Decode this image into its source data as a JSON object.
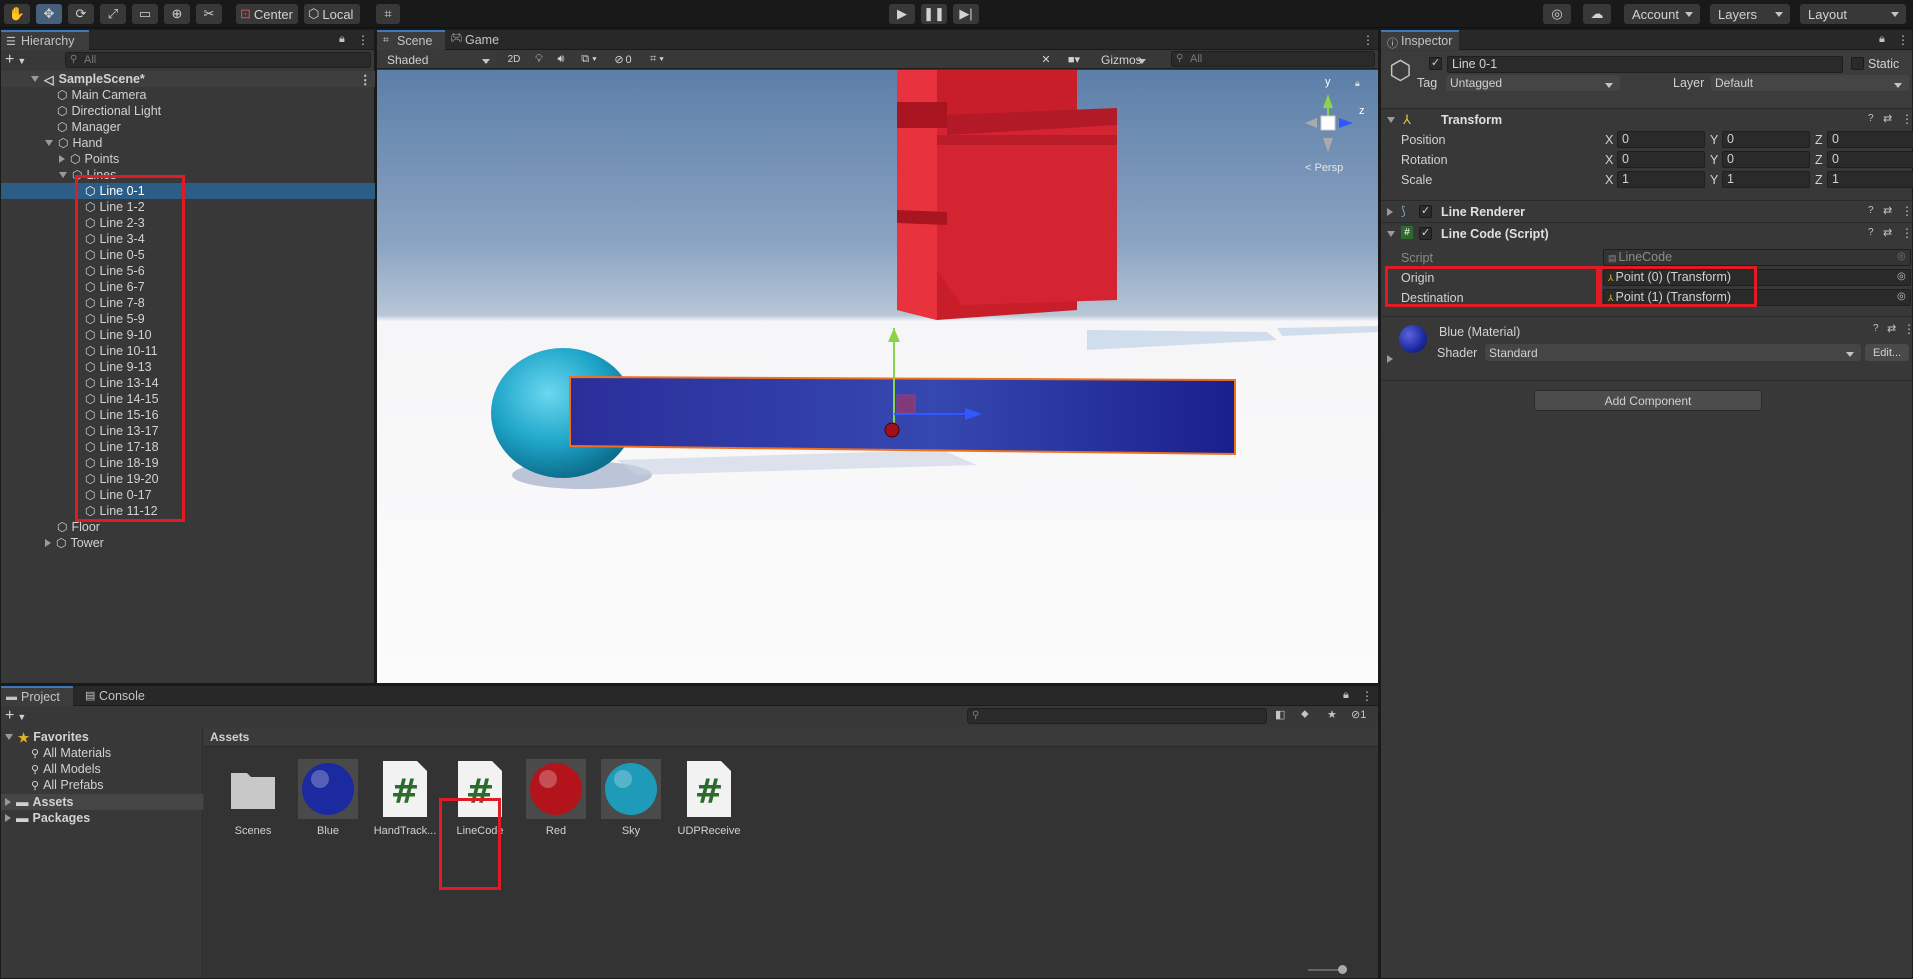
{
  "toolbar": {
    "tools": [
      "hand-tool",
      "move-tool",
      "rotate-tool",
      "scale-tool",
      "rect-tool",
      "transform-tool",
      "custom-tool"
    ],
    "pivot_mode": "Center",
    "pivot_rotation": "Local",
    "account": "Account",
    "layers": "Layers",
    "layout": "Layout"
  },
  "hierarchy": {
    "tab": "Hierarchy",
    "search_placeholder": "All",
    "scene": "SampleScene*",
    "items": [
      {
        "label": "Main Camera"
      },
      {
        "label": "Directional Light"
      },
      {
        "label": "Manager"
      },
      {
        "label": "Hand"
      },
      {
        "label": "Points"
      },
      {
        "label": "Lines"
      },
      {
        "label": "Line 0-1"
      },
      {
        "label": "Line 1-2"
      },
      {
        "label": "Line 2-3"
      },
      {
        "label": "Line 3-4"
      },
      {
        "label": "Line 0-5"
      },
      {
        "label": "Line 5-6"
      },
      {
        "label": "Line 6-7"
      },
      {
        "label": "Line 7-8"
      },
      {
        "label": "Line 5-9"
      },
      {
        "label": "Line 9-10"
      },
      {
        "label": "Line 10-11"
      },
      {
        "label": "Line 9-13"
      },
      {
        "label": "Line 13-14"
      },
      {
        "label": "Line 14-15"
      },
      {
        "label": "Line 15-16"
      },
      {
        "label": "Line 13-17"
      },
      {
        "label": "Line 17-18"
      },
      {
        "label": "Line 18-19"
      },
      {
        "label": "Line 19-20"
      },
      {
        "label": "Line 0-17"
      },
      {
        "label": "Line 11-12"
      },
      {
        "label": "Floor"
      },
      {
        "label": "Tower"
      }
    ]
  },
  "scene_view": {
    "tabs": [
      "Scene",
      "Game"
    ],
    "shading": "Shaded",
    "mode_2d": "2D",
    "hidden_count": "0",
    "gizmos": "Gizmos",
    "search_placeholder": "All",
    "persp": "< Persp",
    "axis_y": "y",
    "axis_z": "z"
  },
  "inspector": {
    "tab": "Inspector",
    "object_name": "Line 0-1",
    "static_label": "Static",
    "tag_label": "Tag",
    "tag_value": "Untagged",
    "layer_label": "Layer",
    "layer_value": "Default",
    "transform": {
      "title": "Transform",
      "position_label": "Position",
      "rotation_label": "Rotation",
      "scale_label": "Scale",
      "axes": [
        "X",
        "Y",
        "Z"
      ],
      "position": [
        "0",
        "0",
        "0"
      ],
      "rotation": [
        "0",
        "0",
        "0"
      ],
      "scale": [
        "1",
        "1",
        "1"
      ]
    },
    "line_renderer": "Line Renderer",
    "line_code": {
      "title": "Line Code (Script)",
      "script_label": "Script",
      "script_value": "LineCode",
      "origin_label": "Origin",
      "origin_value": "Point (0) (Transform)",
      "destination_label": "Destination",
      "destination_value": "Point (1) (Transform)"
    },
    "material": {
      "name": "Blue (Material)",
      "shader_label": "Shader",
      "shader_value": "Standard",
      "edit_label": "Edit..."
    },
    "add_component": "Add Component"
  },
  "project": {
    "tabs": [
      "Project",
      "Console"
    ],
    "hidden_count": "1",
    "favorites": "Favorites",
    "favorite_items": [
      "All Materials",
      "All Models",
      "All Prefabs"
    ],
    "roots": [
      "Assets",
      "Packages"
    ],
    "breadcrumb": "Assets",
    "assets": [
      {
        "label": "Scenes",
        "kind": "folder"
      },
      {
        "label": "Blue",
        "kind": "material",
        "color": "#1c2aa0"
      },
      {
        "label": "HandTrack...",
        "kind": "script"
      },
      {
        "label": "LineCode",
        "kind": "script"
      },
      {
        "label": "Red",
        "kind": "material",
        "color": "#b3141c"
      },
      {
        "label": "Sky",
        "kind": "material",
        "color": "#1e9bb8"
      },
      {
        "label": "UDPReceive",
        "kind": "script"
      }
    ]
  },
  "colors": {
    "accent": "#3a79bb",
    "selection": "#2c5d87",
    "highlight": "#e01b24"
  }
}
